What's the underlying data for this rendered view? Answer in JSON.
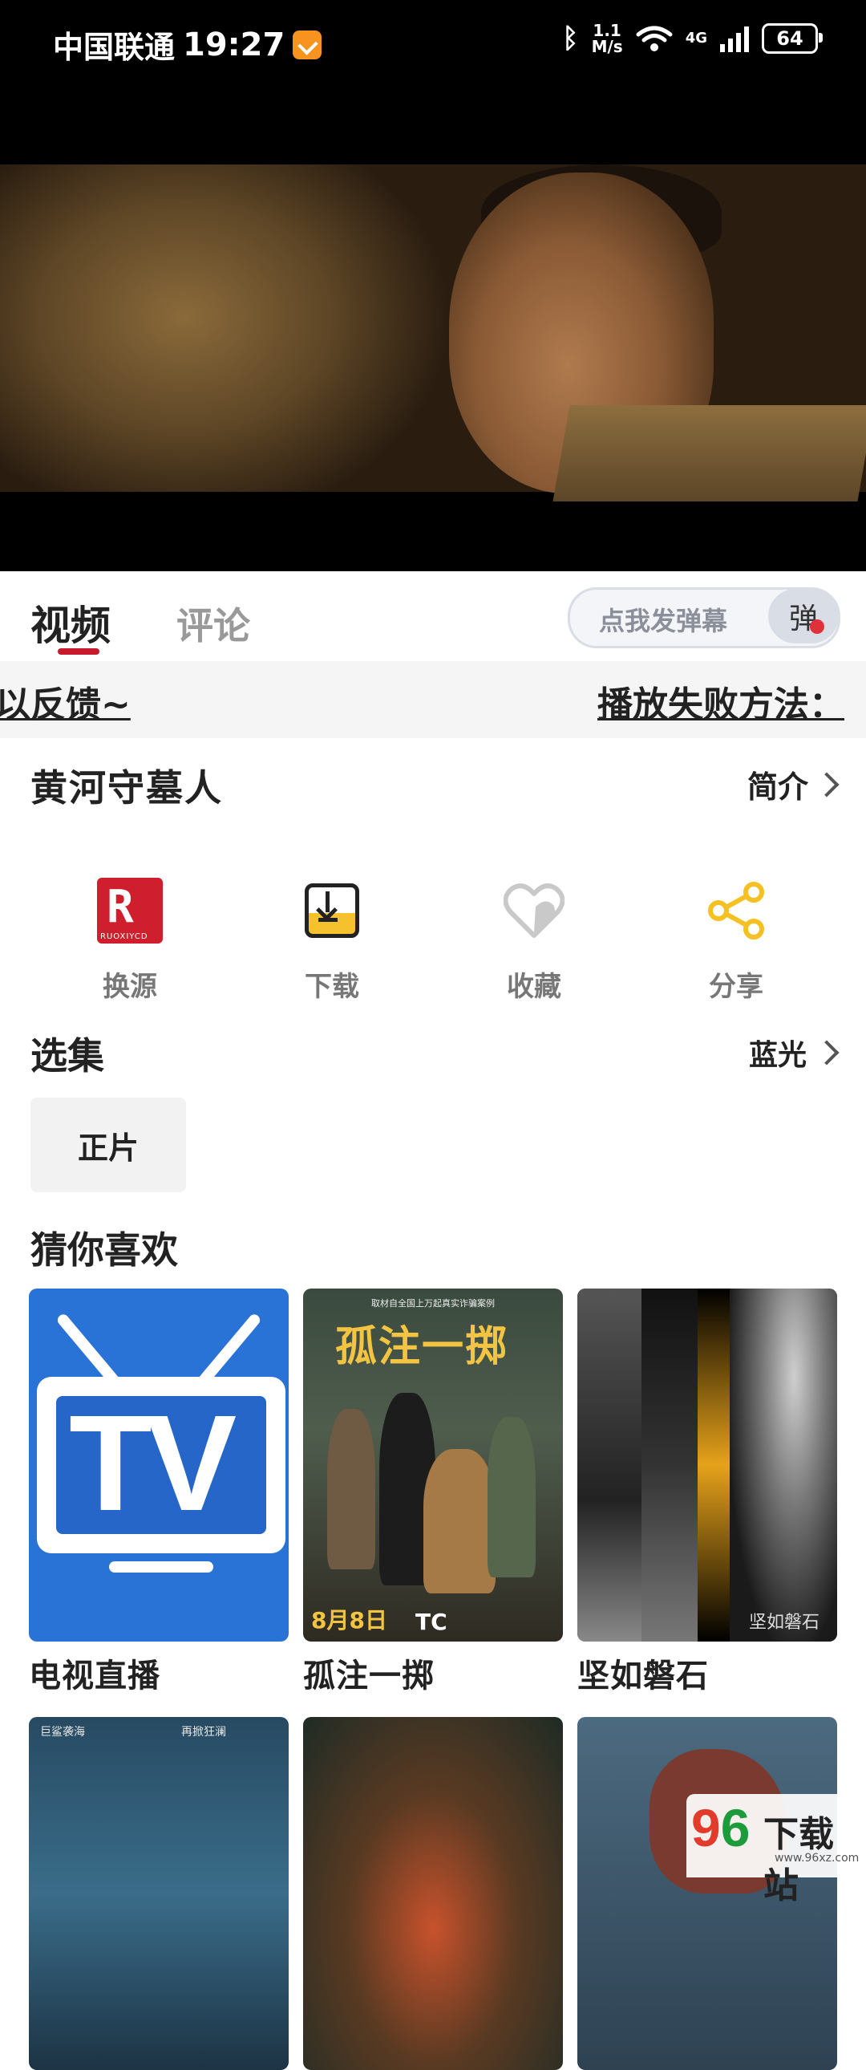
{
  "status_bar": {
    "carrier": "中国联通",
    "time": "19:27",
    "speed_value": "1.1",
    "speed_unit": "M/s",
    "network": "4G",
    "battery": "64"
  },
  "tabs": {
    "video": "视频",
    "comment": "评论"
  },
  "danmaku": {
    "placeholder": "点我发弹幕",
    "button": "弹"
  },
  "marquee": {
    "left": "以反馈~",
    "right": "播放失败方法："
  },
  "movie": {
    "title": "黄河守墓人",
    "intro_label": "简介"
  },
  "actions": [
    {
      "label": "换源",
      "icon": "ruoxiyc-logo-icon"
    },
    {
      "label": "下载",
      "icon": "download-icon"
    },
    {
      "label": "收藏",
      "icon": "heart-icon"
    },
    {
      "label": "分享",
      "icon": "share-icon"
    }
  ],
  "source_icon_text": "RUOXIYCD",
  "episodes": {
    "title": "选集",
    "quality": "蓝光",
    "items": [
      "正片"
    ]
  },
  "recommend": {
    "title": "猜你喜欢",
    "items": [
      {
        "title": "电视直播",
        "poster_text": "TV"
      },
      {
        "title": "孤注一掷",
        "poster_text": "孤注一掷",
        "poster_date": "8月8日",
        "poster_badge": "TC"
      },
      {
        "title": "坚如磐石",
        "poster_text": "坚如磐石"
      },
      {
        "title": ""
      },
      {
        "title": ""
      },
      {
        "title": ""
      }
    ],
    "poster_tags": {
      "gz_header": "取材自全国上万起真实诈骗案例",
      "sea_left": "巨鲨袭海",
      "sea_right": "再掀狂澜"
    }
  },
  "watermark": {
    "logo_digits": "9",
    "logo_digits_2": "6",
    "name": "下载站",
    "url": "www.96xz.com"
  },
  "colors": {
    "accent": "#c81a2c",
    "source_icon": "#cf1f2e",
    "download_yellow": "#f5c22e",
    "share_yellow": "#f5c022"
  }
}
